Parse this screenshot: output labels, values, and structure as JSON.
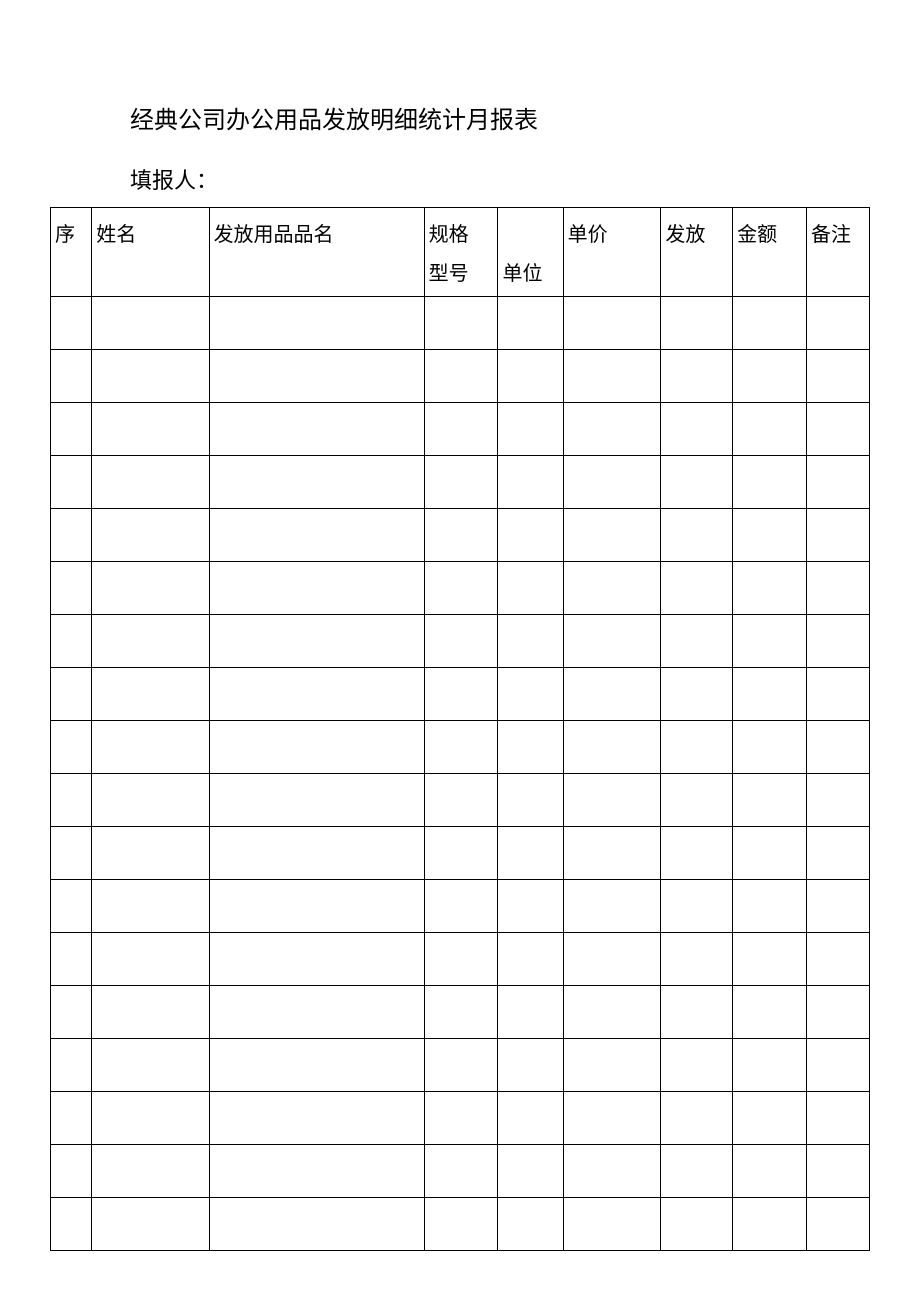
{
  "title": "经典公司办公用品发放明细统计月报表",
  "reporter_label": "填报人：",
  "headers": {
    "seq": "序",
    "name": "姓名",
    "item": "发放用品品名",
    "spec_line1": "规格",
    "spec_line2": "型号",
    "unit": "单位",
    "price": "单价",
    "qty": "发放",
    "amount": "金额",
    "remark": "备注"
  },
  "rows": [
    {
      "seq": "",
      "name": "",
      "item": "",
      "spec": "",
      "unit": "",
      "price": "",
      "qty": "",
      "amount": "",
      "remark": ""
    },
    {
      "seq": "",
      "name": "",
      "item": "",
      "spec": "",
      "unit": "",
      "price": "",
      "qty": "",
      "amount": "",
      "remark": ""
    },
    {
      "seq": "",
      "name": "",
      "item": "",
      "spec": "",
      "unit": "",
      "price": "",
      "qty": "",
      "amount": "",
      "remark": ""
    },
    {
      "seq": "",
      "name": "",
      "item": "",
      "spec": "",
      "unit": "",
      "price": "",
      "qty": "",
      "amount": "",
      "remark": ""
    },
    {
      "seq": "",
      "name": "",
      "item": "",
      "spec": "",
      "unit": "",
      "price": "",
      "qty": "",
      "amount": "",
      "remark": ""
    },
    {
      "seq": "",
      "name": "",
      "item": "",
      "spec": "",
      "unit": "",
      "price": "",
      "qty": "",
      "amount": "",
      "remark": ""
    },
    {
      "seq": "",
      "name": "",
      "item": "",
      "spec": "",
      "unit": "",
      "price": "",
      "qty": "",
      "amount": "",
      "remark": ""
    },
    {
      "seq": "",
      "name": "",
      "item": "",
      "spec": "",
      "unit": "",
      "price": "",
      "qty": "",
      "amount": "",
      "remark": ""
    },
    {
      "seq": "",
      "name": "",
      "item": "",
      "spec": "",
      "unit": "",
      "price": "",
      "qty": "",
      "amount": "",
      "remark": ""
    },
    {
      "seq": "",
      "name": "",
      "item": "",
      "spec": "",
      "unit": "",
      "price": "",
      "qty": "",
      "amount": "",
      "remark": ""
    },
    {
      "seq": "",
      "name": "",
      "item": "",
      "spec": "",
      "unit": "",
      "price": "",
      "qty": "",
      "amount": "",
      "remark": ""
    },
    {
      "seq": "",
      "name": "",
      "item": "",
      "spec": "",
      "unit": "",
      "price": "",
      "qty": "",
      "amount": "",
      "remark": ""
    },
    {
      "seq": "",
      "name": "",
      "item": "",
      "spec": "",
      "unit": "",
      "price": "",
      "qty": "",
      "amount": "",
      "remark": ""
    },
    {
      "seq": "",
      "name": "",
      "item": "",
      "spec": "",
      "unit": "",
      "price": "",
      "qty": "",
      "amount": "",
      "remark": ""
    },
    {
      "seq": "",
      "name": "",
      "item": "",
      "spec": "",
      "unit": "",
      "price": "",
      "qty": "",
      "amount": "",
      "remark": ""
    },
    {
      "seq": "",
      "name": "",
      "item": "",
      "spec": "",
      "unit": "",
      "price": "",
      "qty": "",
      "amount": "",
      "remark": ""
    },
    {
      "seq": "",
      "name": "",
      "item": "",
      "spec": "",
      "unit": "",
      "price": "",
      "qty": "",
      "amount": "",
      "remark": ""
    },
    {
      "seq": "",
      "name": "",
      "item": "",
      "spec": "",
      "unit": "",
      "price": "",
      "qty": "",
      "amount": "",
      "remark": ""
    }
  ]
}
